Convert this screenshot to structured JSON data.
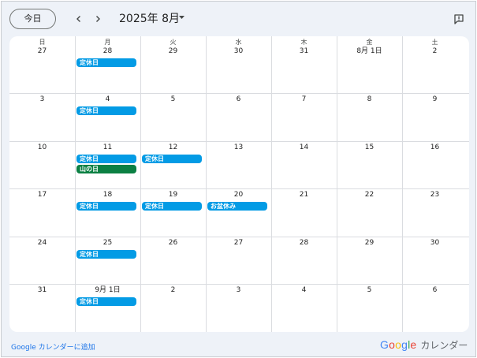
{
  "toolbar": {
    "today_label": "今日",
    "month_title": "2025年 8月",
    "prev_icon": "chevron-left-icon",
    "next_icon": "chevron-right-icon",
    "caret_icon": "caret-down-icon",
    "feedback_icon": "feedback-icon"
  },
  "weekdays": [
    "日",
    "月",
    "火",
    "水",
    "木",
    "金",
    "土"
  ],
  "weeks": [
    [
      {
        "label": "27",
        "events": []
      },
      {
        "label": "28",
        "events": [
          {
            "title": "定休日",
            "type": "closed"
          }
        ]
      },
      {
        "label": "29",
        "events": []
      },
      {
        "label": "30",
        "events": []
      },
      {
        "label": "31",
        "events": []
      },
      {
        "label": "8月 1日",
        "events": []
      },
      {
        "label": "2",
        "events": []
      }
    ],
    [
      {
        "label": "3",
        "events": []
      },
      {
        "label": "4",
        "events": [
          {
            "title": "定休日",
            "type": "closed"
          }
        ]
      },
      {
        "label": "5",
        "events": []
      },
      {
        "label": "6",
        "events": []
      },
      {
        "label": "7",
        "events": []
      },
      {
        "label": "8",
        "events": []
      },
      {
        "label": "9",
        "events": []
      }
    ],
    [
      {
        "label": "10",
        "events": []
      },
      {
        "label": "11",
        "events": [
          {
            "title": "定休日",
            "type": "closed"
          },
          {
            "title": "山の日",
            "type": "holiday"
          }
        ]
      },
      {
        "label": "12",
        "events": [
          {
            "title": "定休日",
            "type": "closed"
          }
        ]
      },
      {
        "label": "13",
        "events": []
      },
      {
        "label": "14",
        "events": []
      },
      {
        "label": "15",
        "events": []
      },
      {
        "label": "16",
        "events": []
      }
    ],
    [
      {
        "label": "17",
        "events": []
      },
      {
        "label": "18",
        "events": [
          {
            "title": "定休日",
            "type": "closed"
          }
        ]
      },
      {
        "label": "19",
        "events": [
          {
            "title": "定休日",
            "type": "closed"
          }
        ]
      },
      {
        "label": "20",
        "events": [
          {
            "title": "お盆休み",
            "type": "closed"
          }
        ]
      },
      {
        "label": "21",
        "events": []
      },
      {
        "label": "22",
        "events": []
      },
      {
        "label": "23",
        "events": []
      }
    ],
    [
      {
        "label": "24",
        "events": []
      },
      {
        "label": "25",
        "events": [
          {
            "title": "定休日",
            "type": "closed"
          }
        ]
      },
      {
        "label": "26",
        "events": []
      },
      {
        "label": "27",
        "events": []
      },
      {
        "label": "28",
        "events": []
      },
      {
        "label": "29",
        "events": []
      },
      {
        "label": "30",
        "events": []
      }
    ],
    [
      {
        "label": "31",
        "events": []
      },
      {
        "label": "9月 1日",
        "events": [
          {
            "title": "定休日",
            "type": "closed"
          }
        ]
      },
      {
        "label": "2",
        "events": []
      },
      {
        "label": "3",
        "events": []
      },
      {
        "label": "4",
        "events": []
      },
      {
        "label": "5",
        "events": []
      },
      {
        "label": "6",
        "events": []
      }
    ]
  ],
  "colors": {
    "closed": "#039be5",
    "holiday": "#0b8043",
    "link": "#1a73e8"
  },
  "footer": {
    "add_link": "Google カレンダーに追加",
    "brand_logo_letters": [
      "G",
      "o",
      "o",
      "g",
      "l",
      "e"
    ],
    "brand_logo_colors": [
      "#4285f4",
      "#ea4335",
      "#fbbc05",
      "#4285f4",
      "#34a853",
      "#ea4335"
    ],
    "brand_product": "カレンダー"
  }
}
